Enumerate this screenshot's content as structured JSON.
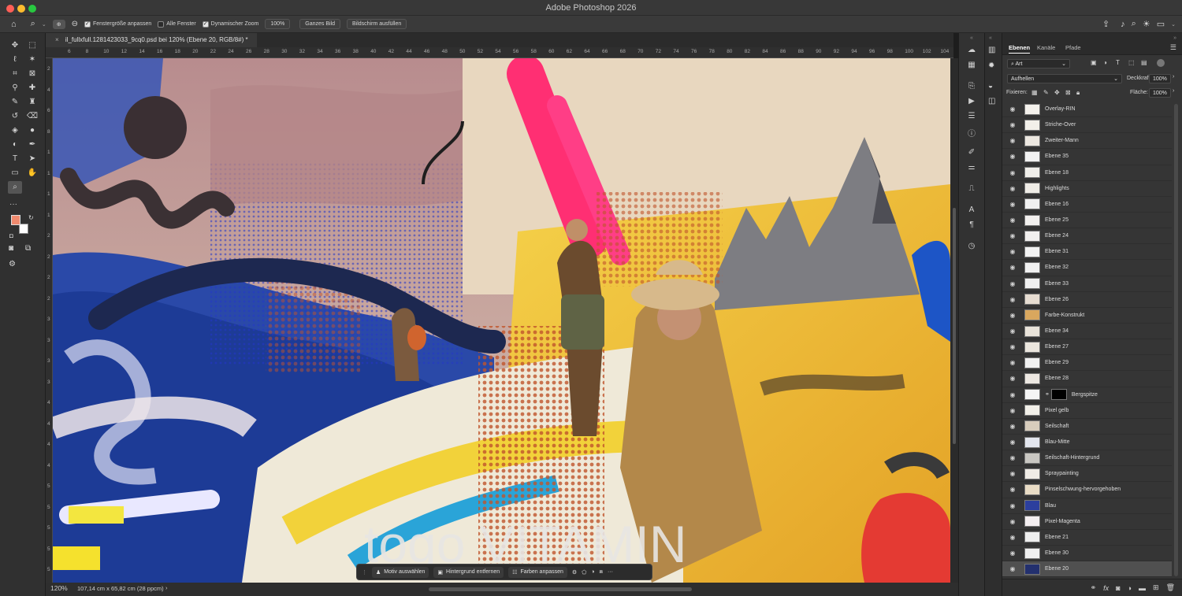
{
  "window": {
    "title": "Adobe Photoshop 2026",
    "traffic_lights": [
      "#ff5f57",
      "#febc2e",
      "#28c840"
    ]
  },
  "options_bar": {
    "home_icon": "home-icon",
    "zoom_tool_icon": "magnifier-icon",
    "zoom_in_icon": "zoom-in-icon",
    "zoom_out_icon": "zoom-out-icon",
    "resize_windows": {
      "label": "Fenstergröße anpassen",
      "checked": true
    },
    "all_windows": {
      "label": "Alle Fenster",
      "checked": false
    },
    "scrubby_zoom": {
      "label": "Dynamischer Zoom",
      "checked": true
    },
    "zoom_value": "100%",
    "fit_screen": "Ganzes Bild",
    "fill_screen": "Bildschirm ausfüllen",
    "right_icons": [
      "share-icon",
      "bell-icon",
      "search-icon",
      "lightbulb-icon",
      "workspace-icon"
    ]
  },
  "document": {
    "tab_close": "×",
    "tab_title": "il_fullxfull.1281423033_9cq0.psd bei 120% (Ebene 20, RGB/8#) *",
    "ruler_top": [
      "6",
      "8",
      "10",
      "12",
      "14",
      "16",
      "18",
      "20",
      "22",
      "24",
      "26",
      "28",
      "30",
      "32",
      "34",
      "36",
      "38",
      "40",
      "42",
      "44",
      "46",
      "48",
      "50",
      "52",
      "54",
      "56",
      "58",
      "60",
      "62",
      "64",
      "66",
      "68",
      "70",
      "72",
      "74",
      "76",
      "78",
      "80",
      "82",
      "84",
      "86",
      "88",
      "90",
      "92",
      "94",
      "96",
      "98",
      "100",
      "102",
      "104"
    ],
    "ruler_left": [
      "2",
      "4",
      "6",
      "8",
      "1",
      "1",
      "1",
      "1",
      "2",
      "2",
      "2",
      "2",
      "3",
      "3",
      "3",
      "3",
      "4",
      "4",
      "4",
      "4",
      "5",
      "5",
      "5",
      "5",
      "5"
    ]
  },
  "status": {
    "zoom": "120%",
    "size": "107,14 cm x 65,82 cm (28 ppcm)",
    "arrow": "›"
  },
  "context_bar": {
    "select_subject": "Motiv auswählen",
    "remove_bg": "Hintergrund entfernen",
    "adjust_colors": "Farben anpassen",
    "more": "···"
  },
  "colors": {
    "foreground": "#f08a6e",
    "background": "#ffffff",
    "accent_selected": "#505050"
  },
  "panel": {
    "tabs": [
      "Ebenen",
      "Kanäle",
      "Pfade"
    ],
    "active_tab": "Ebenen",
    "filter_kind": "Art",
    "blend_mode": "Aufhellen",
    "opacity_label": "Deckkraft:",
    "opacity_value": "100%",
    "lock_label": "Fixieren:",
    "fill_label": "Fläche:",
    "fill_value": "100%"
  },
  "layers": [
    {
      "name": "Overlay-RIN",
      "thumb": "#f4f1ec"
    },
    {
      "name": "Striche-Over",
      "thumb": "#f3f0ea"
    },
    {
      "name": "Zweiter-Mann",
      "thumb": "#ece7e0"
    },
    {
      "name": "Ebene 35",
      "thumb": "#f2f2f2"
    },
    {
      "name": "Ebene 18",
      "thumb": "#f0eeea"
    },
    {
      "name": "Highlights",
      "thumb": "#efece6"
    },
    {
      "name": "Ebene 16",
      "thumb": "#f1f1f1"
    },
    {
      "name": "Ebene 25",
      "thumb": "#f2f0ee"
    },
    {
      "name": "Ebene 24",
      "thumb": "#f1efee"
    },
    {
      "name": "Ebene 31",
      "thumb": "#f2f2f2"
    },
    {
      "name": "Ebene 32",
      "thumb": "#f1f1f1"
    },
    {
      "name": "Ebene 33",
      "thumb": "#f0f0f0"
    },
    {
      "name": "Ebene 26",
      "thumb": "#e7ddd2"
    },
    {
      "name": "Farbe-Konstrukt",
      "thumb": "#d9a75e"
    },
    {
      "name": "Ebene 34",
      "thumb": "#e9e3da"
    },
    {
      "name": "Ebene 27",
      "thumb": "#ebe6de"
    },
    {
      "name": "Ebene 29",
      "thumb": "#f1f1f1"
    },
    {
      "name": "Ebene 28",
      "thumb": "#ede8e2"
    },
    {
      "name": "Bergspitze",
      "thumb": "#f4f4f4",
      "mask": true
    },
    {
      "name": "Pixel gelb",
      "thumb": "#f1efe8"
    },
    {
      "name": "Seilschaft",
      "thumb": "#d8cdbd"
    },
    {
      "name": "Blau-Mitte",
      "thumb": "#e3e6ee"
    },
    {
      "name": "Seilschaft-Hintergrund",
      "thumb": "#c9c7c2"
    },
    {
      "name": "Spraypainting",
      "thumb": "#f0ece6"
    },
    {
      "name": "Pinselschwung-hervorgehoben",
      "thumb": "#e9dcc5"
    },
    {
      "name": "Blau",
      "thumb": "#2c3f9e"
    },
    {
      "name": "Pixel-Magenta",
      "thumb": "#f3eef0"
    },
    {
      "name": "Ebene 21",
      "thumb": "#eeeeee"
    },
    {
      "name": "Ebene 30",
      "thumb": "#efefef"
    },
    {
      "name": "Ebene 20",
      "thumb": "#23306e",
      "selected": true
    }
  ],
  "canvas": {
    "lettering": "togo VITAMIN"
  }
}
